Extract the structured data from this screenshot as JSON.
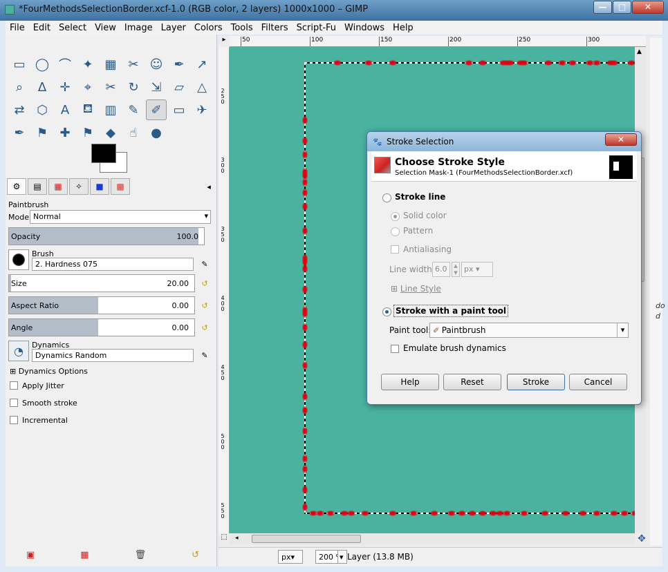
{
  "window": {
    "title": "*FourMethodsSelectionBorder.xcf-1.0 (RGB color, 2 layers) 1000x1000 – GIMP",
    "minimize_glyph": "—",
    "maximize_glyph": "□",
    "close_glyph": "✕"
  },
  "menubar": [
    "File",
    "Edit",
    "Select",
    "View",
    "Image",
    "Layer",
    "Colors",
    "Tools",
    "Filters",
    "Script-Fu",
    "Windows",
    "Help"
  ],
  "toolbox": {
    "tools": [
      {
        "name": "rect-select-icon",
        "glyph": "▭"
      },
      {
        "name": "ellipse-select-icon",
        "glyph": "◯"
      },
      {
        "name": "free-select-icon",
        "glyph": "⌒"
      },
      {
        "name": "fuzzy-select-icon",
        "glyph": "✦"
      },
      {
        "name": "color-select-icon",
        "glyph": "▦"
      },
      {
        "name": "scissors-icon",
        "glyph": "✂"
      },
      {
        "name": "foreground-select-icon",
        "glyph": "☺"
      },
      {
        "name": "paths-icon",
        "glyph": "✒"
      },
      {
        "name": "color-picker-icon",
        "glyph": "↗"
      },
      {
        "name": "zoom-icon",
        "glyph": "⌕"
      },
      {
        "name": "measure-icon",
        "glyph": "∆"
      },
      {
        "name": "move-icon",
        "glyph": "✛"
      },
      {
        "name": "align-icon",
        "glyph": "⌖"
      },
      {
        "name": "crop-icon",
        "glyph": "✂"
      },
      {
        "name": "rotate-icon",
        "glyph": "↻"
      },
      {
        "name": "scale-icon",
        "glyph": "⇲"
      },
      {
        "name": "shear-icon",
        "glyph": "▱"
      },
      {
        "name": "perspective-icon",
        "glyph": "△"
      },
      {
        "name": "flip-icon",
        "glyph": "⇄"
      },
      {
        "name": "cage-icon",
        "glyph": "⬡"
      },
      {
        "name": "text-icon",
        "glyph": "A"
      },
      {
        "name": "bucket-fill-icon",
        "glyph": "⛾"
      },
      {
        "name": "blend-icon",
        "glyph": "▥"
      },
      {
        "name": "pencil-icon",
        "glyph": "✎"
      },
      {
        "name": "paintbrush-icon",
        "glyph": "✐"
      },
      {
        "name": "eraser-icon",
        "glyph": "▭"
      },
      {
        "name": "airbrush-icon",
        "glyph": "✈"
      },
      {
        "name": "ink-icon",
        "glyph": "✒"
      },
      {
        "name": "clone-icon",
        "glyph": "⚑"
      },
      {
        "name": "heal-icon",
        "glyph": "✚"
      },
      {
        "name": "perspective-clone-icon",
        "glyph": "⚑"
      },
      {
        "name": "blur-icon",
        "glyph": "◆"
      },
      {
        "name": "smudge-icon",
        "glyph": "☝"
      },
      {
        "name": "dodge-burn-icon",
        "glyph": "●"
      }
    ],
    "active_tool_index": 24,
    "panel_title": "Paintbrush",
    "mode_label": "Mode:",
    "mode_value": "Normal",
    "opacity_label": "Opacity",
    "opacity_value": "100.0",
    "opacity_level": 0.97,
    "brush_label": "Brush",
    "brush_value": "2. Hardness 075",
    "size_label": "Size",
    "size_value": "20.00",
    "size_level": 0.01,
    "aspect_label": "Aspect Ratio",
    "aspect_value": "0.00",
    "aspect_level": 0.48,
    "angle_label": "Angle",
    "angle_value": "0.00",
    "angle_level": 0.48,
    "dynamics_label": "Dynamics",
    "dynamics_value": "Dynamics Random",
    "dynamics_options": "Dynamics Options",
    "apply_jitter": "Apply Jitter",
    "smooth_stroke": "Smooth stroke",
    "incremental": "Incremental"
  },
  "rulers": {
    "top": [
      "50",
      "100",
      "150",
      "200",
      "250",
      "300"
    ],
    "left": [
      "250",
      "300",
      "350",
      "400",
      "450",
      "500",
      "550"
    ]
  },
  "statusbar": {
    "unit": "px",
    "zoom": "200 %",
    "layer_info": "Layer (13.8 MB)"
  },
  "right_edge_text": [
    "do",
    "d"
  ],
  "dialog": {
    "title": "Stroke Selection",
    "heading": "Choose Stroke Style",
    "subheading": "Selection Mask-1 (FourMethodsSelectionBorder.xcf)",
    "stroke_line": "Stroke line",
    "solid_color": "Solid color",
    "pattern": "Pattern",
    "antialiasing": "Antialiasing",
    "line_width_label": "Line width:",
    "line_width_value": "6.0",
    "line_width_unit": "px",
    "line_style": "Line Style",
    "stroke_paint_tool": "Stroke with a paint tool",
    "paint_tool_label": "Paint tool:",
    "paint_tool_value": "Paintbrush",
    "emulate": "Emulate brush dynamics",
    "buttons": {
      "help": "Help",
      "reset": "Reset",
      "stroke": "Stroke",
      "cancel": "Cancel"
    }
  },
  "colors": {
    "canvas": "#4ab3a0",
    "stroke_red": "#e00010",
    "foreground": "#000000",
    "background": "#ffffff"
  }
}
